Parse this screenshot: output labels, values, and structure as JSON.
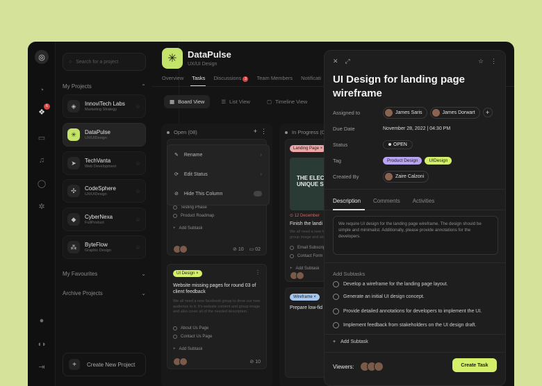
{
  "sidebar": {
    "search_placeholder": "Search for a project",
    "my_projects": "My Projects",
    "projects": [
      {
        "name": "InnoviTech Labs",
        "sub": "Marketing Strategy",
        "icon": "cube-icon"
      },
      {
        "name": "DataPulse",
        "sub": "UX/UIDesign",
        "icon": "asterisk-icon"
      },
      {
        "name": "TechVanta",
        "sub": "Web Development",
        "icon": "arrow-icon"
      },
      {
        "name": "CodeSphere",
        "sub": "UX/UIDesign",
        "icon": "swirl-icon"
      },
      {
        "name": "CyberNexa",
        "sub": "FullProduct",
        "icon": "diamond-icon"
      },
      {
        "name": "ByteFlow",
        "sub": "Graphic Design",
        "icon": "grid-icon"
      }
    ],
    "my_favourites": "My Favourites",
    "archive_projects": "Archive Projects",
    "create_project": "Create New Project"
  },
  "rail": {
    "notif_count": "6"
  },
  "header": {
    "title": "DataPulse",
    "subtitle": "UX/UI Design",
    "tabs": [
      "Overview",
      "Tasks",
      "Discussions",
      "Team Members",
      "Notificati"
    ],
    "discussions_badge": "3",
    "views": [
      "Board View",
      "List View",
      "Timeline View"
    ]
  },
  "board": {
    "open_col": {
      "title": "Open (08)"
    },
    "progress_col": {
      "title": "In Progress (0"
    },
    "menu": [
      "Rename",
      "Edit Status",
      "Hide This Column"
    ],
    "card1": {
      "subtasks": [
        "Testing Phase",
        "Product Roadmap"
      ],
      "add": "Add Subtask",
      "c1": "10",
      "c2": "02"
    },
    "card2": {
      "tag": "UI Design",
      "title": "Website missing pages for round 03 of client feedback",
      "desc": "We all need a new facebook group to drive our new audience to it. It's website content and group image and also cover all of the needed description.",
      "subtasks": [
        "About Us Page",
        "Contact Us Page"
      ],
      "add": "Add Subtask",
      "count": "10"
    },
    "pcard1": {
      "tag": "Landing Page",
      "date": "12 December",
      "title": "Finish the landi",
      "desc": "We all need a new facebook new audience to it. It's group image and also description.",
      "subtasks": [
        "Email Subscrip",
        "Contact Form"
      ],
      "add": "Add Subtask",
      "image_text": "THE ELECT UNIQUE SO"
    },
    "pcard2": {
      "tag": "Wireframe",
      "title": "Prepare low-fid checkout proce"
    }
  },
  "panel": {
    "title": "UI Design for landing page wireframe",
    "assigned_label": "Assigned to",
    "assignees": [
      "James Saris",
      "James Dorwart"
    ],
    "due_label": "Due Date",
    "due": "November 28, 2022 | 04:30 PM",
    "status_label": "Status",
    "status": "OPEN",
    "tag_label": "Tag",
    "tags": [
      {
        "name": "Product Design",
        "color": "#b9a3f3"
      },
      {
        "name": "UIDesign",
        "color": "#d4f06a"
      }
    ],
    "created_label": "Created By",
    "creator": "Zaire Calzoni",
    "tabs": [
      "Description",
      "Comments",
      "Activities"
    ],
    "description": "We require UI design for the landing page wireframe. The design should be simple and minimalist. Additionally, please provide annotations for the developers.",
    "subtasks_label": "Add Subtasks",
    "subtasks": [
      "Develop a wireframe for the landing page layout.",
      "Generate an initial UI design concept.",
      "Provide detailed annotations for developers to implement the UI.",
      "Implement feedback from stakeholders on the UI design draft."
    ],
    "add_subtask": "Add Subtask",
    "viewers_label": "Viewers:",
    "create_task": "Create Task"
  }
}
